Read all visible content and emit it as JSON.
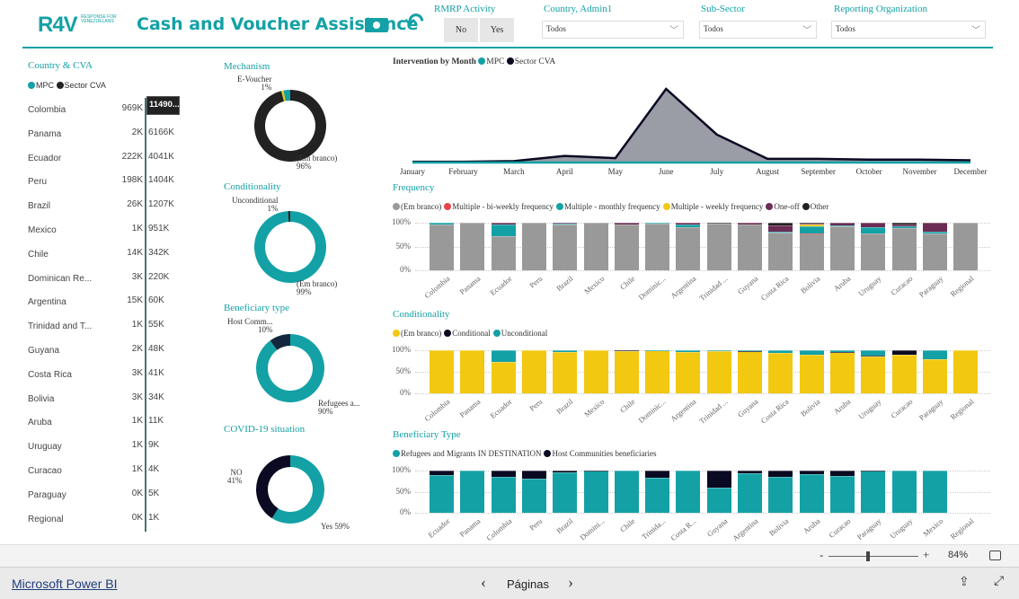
{
  "header": {
    "logo": "R4V",
    "logo_sub": "RESPONSE FOR VENEZUELANS",
    "title": "Cash and Voucher Assistance",
    "money_icon": "money-icon",
    "back_icon": "undo-arrow-icon"
  },
  "filters": {
    "rmrp": {
      "label": "RMRP Activity",
      "options": [
        "No",
        "Yes"
      ]
    },
    "country": {
      "label": "Country, Admin1",
      "value": "Todos"
    },
    "subsector": {
      "label": "Sub-Sector",
      "value": "Todos"
    },
    "org": {
      "label": "Reporting Organization",
      "value": "Todos"
    }
  },
  "country_cva": {
    "title": "Country & CVA",
    "legend": [
      "MPC",
      "Sector CVA"
    ],
    "colors": {
      "mpc": "#13a1a6",
      "sector": "#222222"
    },
    "rows": [
      {
        "name": "Colombia",
        "mpc": "969K",
        "sector": "11490..."
      },
      {
        "name": "Panama",
        "mpc": "2K",
        "sector": "6166K"
      },
      {
        "name": "Ecuador",
        "mpc": "222K",
        "sector": "4041K"
      },
      {
        "name": "Peru",
        "mpc": "198K",
        "sector": "1404K"
      },
      {
        "name": "Brazil",
        "mpc": "26K",
        "sector": "1207K"
      },
      {
        "name": "Mexico",
        "mpc": "1K",
        "sector": "951K"
      },
      {
        "name": "Chile",
        "mpc": "14K",
        "sector": "342K"
      },
      {
        "name": "Dominican Re...",
        "mpc": "3K",
        "sector": "220K"
      },
      {
        "name": "Argentina",
        "mpc": "15K",
        "sector": "60K"
      },
      {
        "name": "Trinidad and T...",
        "mpc": "1K",
        "sector": "55K"
      },
      {
        "name": "Guyana",
        "mpc": "2K",
        "sector": "48K"
      },
      {
        "name": "Costa Rica",
        "mpc": "3K",
        "sector": "41K"
      },
      {
        "name": "Bolivia",
        "mpc": "3K",
        "sector": "34K"
      },
      {
        "name": "Aruba",
        "mpc": "1K",
        "sector": "11K"
      },
      {
        "name": "Uruguay",
        "mpc": "1K",
        "sector": "9K"
      },
      {
        "name": "Curacao",
        "mpc": "1K",
        "sector": "4K"
      },
      {
        "name": "Paraguay",
        "mpc": "0K",
        "sector": "5K"
      },
      {
        "name": "Regional",
        "mpc": "0K",
        "sector": "1K"
      }
    ]
  },
  "donuts": [
    {
      "title": "Mechanism",
      "slices": [
        {
          "label": "(Em branco)",
          "pct": "96%",
          "value": 96,
          "color": "#222222"
        },
        {
          "label": "E-Voucher",
          "pct": "1%",
          "value": 1,
          "color": "#f2c811"
        },
        {
          "label": "",
          "pct": "",
          "value": 3,
          "color": "#13a1a6"
        }
      ]
    },
    {
      "title": "Conditionality",
      "slices": [
        {
          "label": "(Em branco)",
          "pct": "99%",
          "value": 99,
          "color": "#13a1a6"
        },
        {
          "label": "Unconditional",
          "pct": "1%",
          "value": 1,
          "color": "#222222"
        }
      ]
    },
    {
      "title": "Beneficiary type",
      "slices": [
        {
          "label": "Refugees a...",
          "pct": "90%",
          "value": 90,
          "color": "#13a1a6"
        },
        {
          "label": "Host Comm...",
          "pct": "10%",
          "value": 10,
          "color": "#14263d"
        }
      ]
    },
    {
      "title": "COVID-19 situation",
      "slices": [
        {
          "label": "Yes 59%",
          "pct": "",
          "value": 59,
          "color": "#13a1a6"
        },
        {
          "label": "NO",
          "pct": "41%",
          "value": 41,
          "color": "#0a0a22"
        }
      ]
    }
  ],
  "chart_data": [
    {
      "type": "area",
      "title": "Intervention by Month",
      "categories": [
        "January",
        "February",
        "March",
        "April",
        "May",
        "June",
        "July",
        "August",
        "September",
        "October",
        "November",
        "December"
      ],
      "series": [
        {
          "name": "MPC",
          "values": [
            0,
            0,
            0,
            0,
            0,
            0,
            0,
            0,
            0,
            0,
            0,
            0
          ],
          "color": "#13a1a6"
        },
        {
          "name": "Sector CVA",
          "values": [
            1,
            1,
            2,
            9,
            6,
            100,
            38,
            5,
            5,
            4,
            4,
            3
          ],
          "color": "#0a0a22"
        }
      ]
    },
    {
      "type": "bar",
      "stacked": true,
      "title": "Frequency",
      "yticks": [
        "100%",
        "50%",
        "0%"
      ],
      "categories": [
        "Colombia",
        "Panama",
        "Ecuador",
        "Peru",
        "Brazil",
        "Mexico",
        "Chile",
        "Dominic...",
        "Argentina",
        "Trinidad ...",
        "Guyana",
        "Costa Rica",
        "Bolivia",
        "Aruba",
        "Uruguay",
        "Curacao",
        "Paraguay",
        "Regional"
      ],
      "series": [
        {
          "name": "(Em branco)",
          "color": "#999999",
          "values": [
            97,
            100,
            71,
            100,
            96,
            100,
            96,
            99,
            91,
            98,
            97,
            80,
            77,
            92,
            78,
            89,
            78,
            100
          ]
        },
        {
          "name": "Multiple - bi-weekly frequency",
          "color": "#e8444a",
          "values": [
            0,
            0,
            0,
            0,
            0,
            0,
            0,
            0,
            0,
            0,
            0,
            0,
            1,
            0,
            0,
            0,
            0,
            0
          ]
        },
        {
          "name": "Multiple - monthly frequency",
          "color": "#13a1a6",
          "values": [
            3,
            0,
            26,
            0,
            3,
            0,
            0,
            1,
            5,
            0,
            0,
            1,
            15,
            2,
            12,
            3,
            4,
            0
          ]
        },
        {
          "name": "Multiple - weekly frequency",
          "color": "#f2c811",
          "values": [
            0,
            0,
            0,
            0,
            0,
            0,
            0,
            0,
            0,
            0,
            0,
            0,
            3,
            0,
            0,
            0,
            0,
            0
          ]
        },
        {
          "name": "One-off",
          "color": "#6b2c55",
          "values": [
            0,
            0,
            3,
            0,
            1,
            0,
            4,
            0,
            4,
            0,
            3,
            13,
            2,
            6,
            10,
            4,
            18,
            0
          ]
        },
        {
          "name": "Other",
          "color": "#222222",
          "values": [
            0,
            0,
            0,
            0,
            0,
            0,
            0,
            0,
            0,
            2,
            0,
            6,
            2,
            0,
            0,
            4,
            0,
            0
          ]
        }
      ]
    },
    {
      "type": "bar",
      "stacked": true,
      "title": "Conditionality",
      "yticks": [
        "100%",
        "50%",
        "0%"
      ],
      "categories": [
        "Colombia",
        "Panama",
        "Ecuador",
        "Peru",
        "Brazil",
        "Mexico",
        "Chile",
        "Dominic...",
        "Argentina",
        "Trinidad ...",
        "Guyana",
        "Costa Rica",
        "Bolivia",
        "Aruba",
        "Uruguay",
        "Curacao",
        "Paraguay",
        "Regional"
      ],
      "series": [
        {
          "name": "(Em branco)",
          "color": "#f2c811",
          "values": [
            100,
            100,
            72,
            100,
            96,
            100,
            97,
            99,
            95,
            98,
            97,
            93,
            90,
            95,
            86,
            90,
            79,
            100
          ]
        },
        {
          "name": "Conditional",
          "color": "#0a0a22",
          "values": [
            0,
            0,
            0,
            0,
            0,
            0,
            3,
            0,
            0,
            1,
            1,
            0,
            0,
            1,
            2,
            10,
            0,
            0
          ]
        },
        {
          "name": "Unconditional",
          "color": "#13a1a6",
          "values": [
            0,
            0,
            28,
            0,
            4,
            0,
            0,
            1,
            5,
            1,
            2,
            7,
            10,
            4,
            12,
            0,
            21,
            0
          ]
        }
      ]
    },
    {
      "type": "bar",
      "stacked": true,
      "title": "Beneficiary Type",
      "yticks": [
        "100%",
        "50%",
        "0%"
      ],
      "categories": [
        "Ecuador",
        "Panama",
        "Colombia",
        "Peru",
        "Brazil",
        "Domini...",
        "Chile",
        "Trinida...",
        "Costa R...",
        "Guyana",
        "Argentina",
        "Bolivia",
        "Aruba",
        "Curacao",
        "Paraguay",
        "Uruguay",
        "Mexico",
        "Regional"
      ],
      "series": [
        {
          "name": "Refugees and Migrants IN DESTINATION",
          "color": "#13a1a6",
          "values": [
            90,
            100,
            85,
            80,
            96,
            99,
            100,
            83,
            100,
            60,
            93,
            86,
            91,
            88,
            99,
            100,
            100,
            0
          ]
        },
        {
          "name": "Host Communities beneficiaries",
          "color": "#0a0a22",
          "values": [
            10,
            0,
            15,
            20,
            4,
            1,
            0,
            17,
            0,
            40,
            7,
            14,
            9,
            12,
            1,
            0,
            0,
            0
          ]
        }
      ]
    }
  ],
  "zoom": {
    "minus": "-",
    "plus": "+",
    "level": "84%",
    "percent": 84
  },
  "footer": {
    "brand": "Microsoft Power BI",
    "pages": "Páginas",
    "prev": "‹",
    "next": "›"
  }
}
